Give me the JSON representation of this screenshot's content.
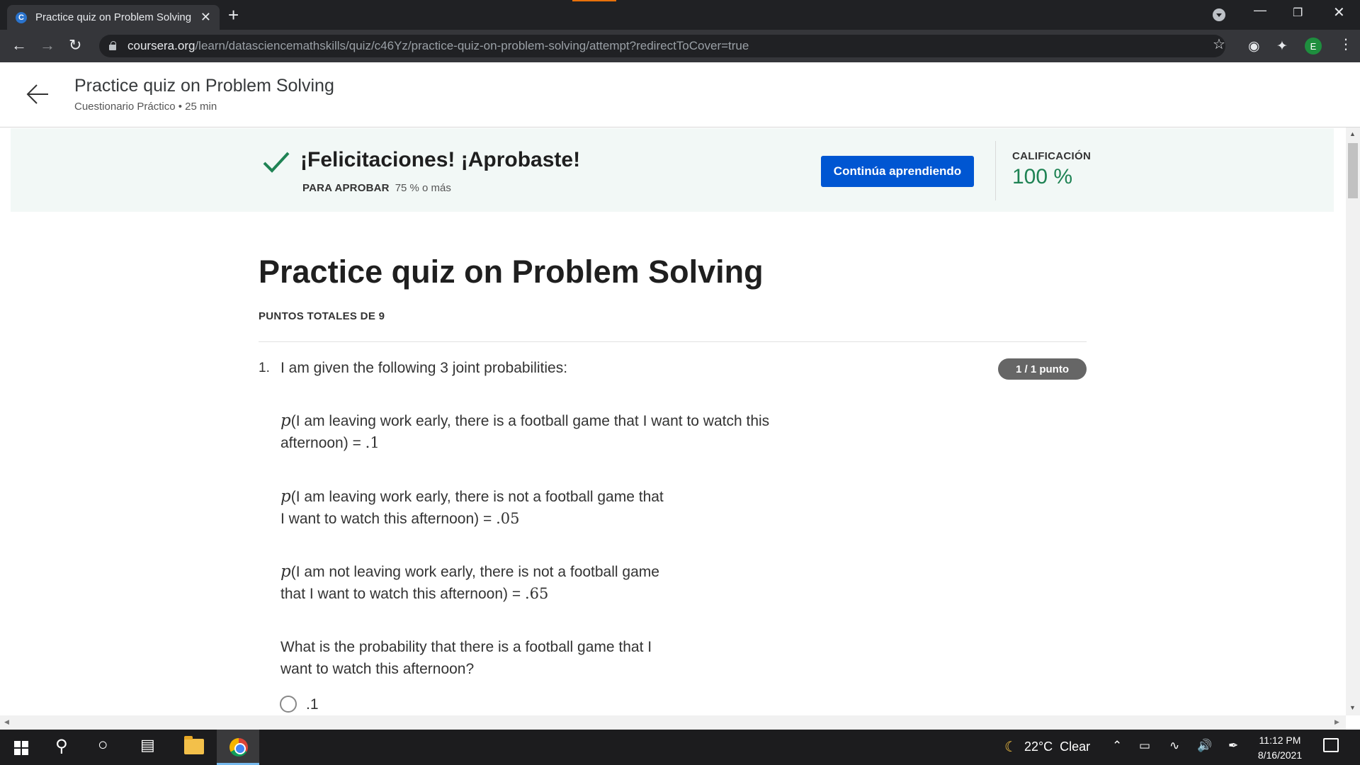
{
  "browser": {
    "tab_title": "Practice quiz on Problem Solving",
    "tab_favicon_letter": "C",
    "tab_close": "✕",
    "new_tab": "+",
    "url_host": "coursera.org",
    "url_path": "/learn/datasciencemathskills/quiz/c46Yz/practice-quiz-on-problem-solving/attempt?redirectToCover=true",
    "profile_letter": "E"
  },
  "header": {
    "title": "Practice quiz on Problem Solving",
    "subtitle": "Cuestionario Práctico • 25 min"
  },
  "banner": {
    "message": "¡Felicitaciones! ¡Aprobaste!",
    "pass_label": "PARA APROBAR",
    "pass_value": "75 % o más",
    "continue_label": "Continúa aprendiendo",
    "grade_label": "CALIFICACIÓN",
    "grade_value": "100 %",
    "accent_color": "#1f8354",
    "button_color": "#0056d2"
  },
  "quiz": {
    "title": "Practice quiz on Problem Solving",
    "total_points": "PUNTOS TOTALES DE 9",
    "question": {
      "number": "1.",
      "text": "I am given the following 3 joint probabilities:",
      "points_badge": "1 / 1 punto",
      "p_symbol": "p",
      "line1a": "(I am leaving work early, there is a football game that I want to watch this",
      "line1b": "afternoon) = ",
      "val1": ".1",
      "line2a": "(I am leaving work early, there is not a football game that",
      "line2b": "I want to watch this afternoon) = ",
      "val2": ".05",
      "line3a": "(I am not leaving work early, there is not a football game",
      "line3b": "that I want to watch this afternoon) = ",
      "val3": ".65",
      "prompt_a": "What is the probability that there is a football game that I",
      "prompt_b": "want to watch this afternoon?",
      "options": [
        ".1"
      ]
    }
  },
  "taskbar": {
    "weather_temp": "22°C",
    "weather_text": "Clear",
    "time": "11:12 PM",
    "date": "8/16/2021"
  }
}
